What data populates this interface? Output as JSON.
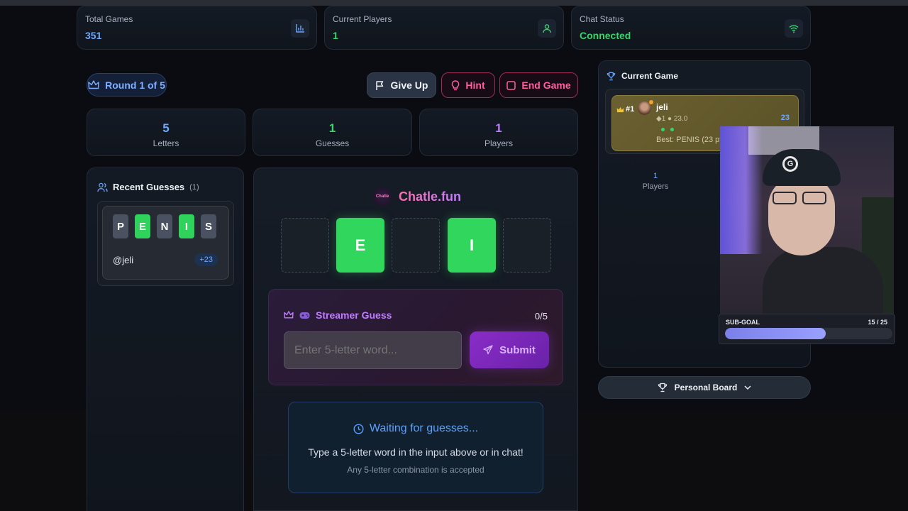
{
  "stats": {
    "total_games": {
      "label": "Total Games",
      "value": "351",
      "color": "#6ea8ff"
    },
    "current_players": {
      "label": "Current Players",
      "value": "1",
      "color": "#39d46a"
    },
    "chat_status": {
      "label": "Chat Status",
      "value": "Connected",
      "color": "#39d46a"
    }
  },
  "round": {
    "label": "Round 1 of 5"
  },
  "actions": {
    "give_up": "Give Up",
    "hint": "Hint",
    "end_game": "End Game"
  },
  "mini_stats": [
    {
      "value": "5",
      "label": "Letters",
      "color": "#6ea8ff"
    },
    {
      "value": "1",
      "label": "Guesses",
      "color": "#39d46a"
    },
    {
      "value": "1",
      "label": "Players",
      "color": "#c07cff"
    }
  ],
  "recent_guesses": {
    "title": "Recent Guesses",
    "count": "(1)",
    "items": [
      {
        "letters": [
          "P",
          "E",
          "N",
          "I",
          "S"
        ],
        "states": [
          "grey",
          "green",
          "grey",
          "green",
          "grey"
        ],
        "user": "@jeli",
        "points": "+23"
      }
    ]
  },
  "brand": {
    "logo_text": "Chatle",
    "name": "Chatle.fun"
  },
  "board": {
    "tiles": [
      "",
      "E",
      "",
      "I",
      ""
    ]
  },
  "streamer_guess": {
    "title": "Streamer Guess",
    "counter": "0/5",
    "placeholder": "Enter 5-letter word...",
    "submit": "Submit"
  },
  "waiting": {
    "title": "Waiting for guesses...",
    "line1": "Type a 5-letter word in the input above or in chat!",
    "line2": "Any 5-letter combination is accepted"
  },
  "current_game": {
    "title": "Current Game",
    "player": {
      "rank": "#1",
      "name": "jeli",
      "meta": "1",
      "score_meta": "23.0",
      "score": "23",
      "best": "Best: PENIS (23 pts)"
    },
    "players_count": "1",
    "players_label": "Players"
  },
  "personal_board": {
    "label": "Personal Board"
  },
  "webcam": {
    "goal_label": "SUB-GOAL",
    "goal_value": "15 / 25",
    "goal_progress": 0.6
  }
}
